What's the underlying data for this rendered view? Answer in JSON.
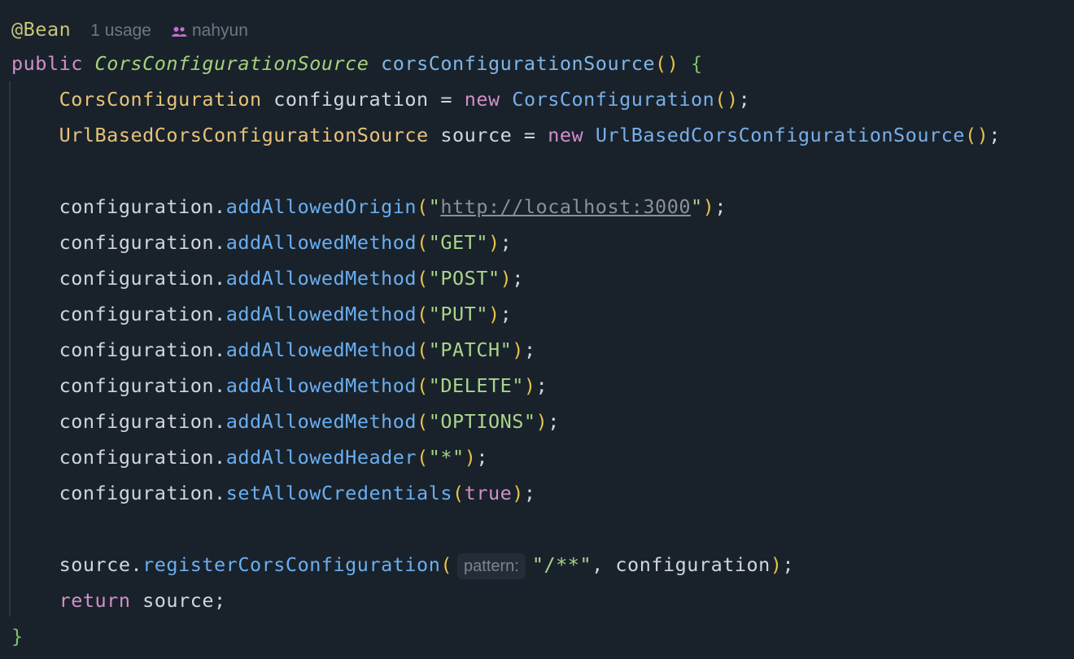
{
  "hint": {
    "annotation": "@Bean",
    "usage": "1 usage",
    "author": "nahyun",
    "author_icon": "people-icon"
  },
  "code": {
    "l1_public": "public",
    "l1_type": "CorsConfigurationSource",
    "l1_method": "corsConfigurationSource",
    "l1_parens": "()",
    "l1_brace": "{",
    "l2_type": "CorsConfiguration",
    "l2_var": "configuration",
    "l2_eq": "=",
    "l2_new": "new",
    "l2_ctor": "CorsConfiguration",
    "l3_type": "UrlBasedCorsConfigurationSource",
    "l3_var": "source",
    "l3_ctor": "UrlBasedCorsConfigurationSource",
    "receiver": "configuration",
    "origin_method": "addAllowedOrigin",
    "origin_url": "http://localhost:3000",
    "method_call": "addAllowedMethod",
    "methods": [
      "GET",
      "POST",
      "PUT",
      "PATCH",
      "DELETE",
      "OPTIONS"
    ],
    "header_method": "addAllowedHeader",
    "header_value": "*",
    "cred_method": "setAllowCredentials",
    "cred_value": "true",
    "source_var": "source",
    "register_method": "registerCorsConfiguration",
    "param_hint": "pattern:",
    "pattern": "/**",
    "return_kw": "return",
    "return_val": "source",
    "close_brace": "}"
  }
}
